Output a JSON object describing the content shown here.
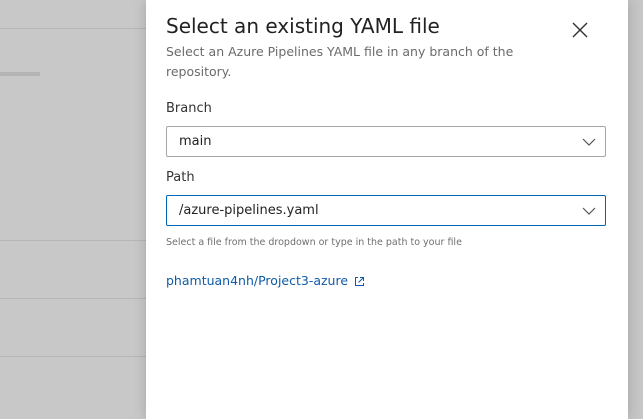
{
  "panel": {
    "title": "Select an existing YAML file",
    "subtitle": "Select an Azure Pipelines YAML file in any branch of the repository.",
    "close_icon": "close-icon"
  },
  "branch": {
    "label": "Branch",
    "value": "main"
  },
  "path": {
    "label": "Path",
    "value": "/azure-pipelines.yaml",
    "helper": "Select a file from the dropdown or type in the path to your file"
  },
  "repository": {
    "link_text": "phamtuan4nh/Project3-azure",
    "link_icon": "external-link-icon"
  },
  "colors": {
    "accent": "#0066b4",
    "link": "#0f5ba8",
    "overlay": "#c8c8c8"
  }
}
